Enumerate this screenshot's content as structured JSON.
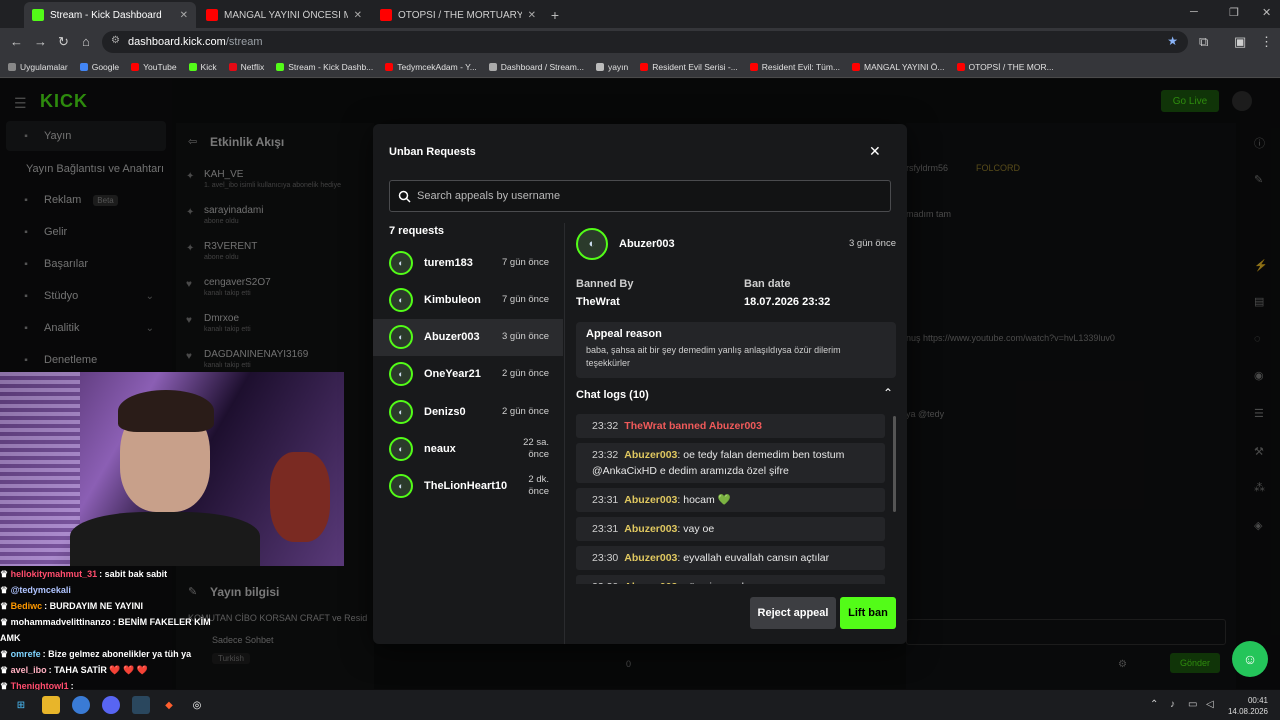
{
  "browser": {
    "tabs": [
      {
        "title": "Stream - Kick Dashboard",
        "favicon_color": "#53fc18",
        "active": true
      },
      {
        "title": "MANGAL YAYINI ÖNCESİ MEKİK",
        "favicon_color": "#ff0000",
        "active": false
      },
      {
        "title": "OTOPSİ / THE MORTUARY ASSI",
        "favicon_color": "#ff0000",
        "active": false
      }
    ],
    "url_host": "dashboard.kick.com",
    "url_path": "/stream",
    "bookmarks": [
      {
        "label": "Uygulamalar",
        "color": "#888888"
      },
      {
        "label": "Google",
        "color": "#4285f4"
      },
      {
        "label": "YouTube",
        "color": "#ff0000"
      },
      {
        "label": "Kick",
        "color": "#53fc18"
      },
      {
        "label": "Netflix",
        "color": "#e50914"
      },
      {
        "label": "Stream - Kick Dashb...",
        "color": "#53fc18"
      },
      {
        "label": "TedymcekAdam - Y...",
        "color": "#ff0000"
      },
      {
        "label": "Dashboard / Stream...",
        "color": "#aaaaaa"
      },
      {
        "label": "yayın",
        "color": "#bbbbbb"
      },
      {
        "label": "Resident Evil Serisi -...",
        "color": "#ff0000"
      },
      {
        "label": "Resident Evil: Tüm...",
        "color": "#ff0000"
      },
      {
        "label": "MANGAL YAYINI Ö...",
        "color": "#ff0000"
      },
      {
        "label": "OTOPSİ / THE MOR...",
        "color": "#ff0000"
      }
    ]
  },
  "dashboard": {
    "logo": "KICK",
    "go_live": "Go Live",
    "sidebar": [
      {
        "label": "Yayın",
        "icon": "broadcast-icon"
      },
      {
        "label": "Yayın Bağlantısı ve Anahtarı",
        "icon": ""
      },
      {
        "label": "Reklam",
        "icon": "ad-icon",
        "badge": "Beta"
      },
      {
        "label": "Gelir",
        "icon": "wallet-icon"
      },
      {
        "label": "Başarılar",
        "icon": "trophy-icon"
      },
      {
        "label": "Stüdyo",
        "icon": "studio-icon"
      },
      {
        "label": "Analitik",
        "icon": "chart-icon"
      },
      {
        "label": "Denetleme",
        "icon": "hammer-icon"
      }
    ],
    "activity_title": "Etkinlik Akışı",
    "activity": [
      {
        "name": "KAH_VE",
        "sub": "1. avel_ibo isimli kullanıcıya abonelik hediye"
      },
      {
        "name": "sarayinadami",
        "sub": "abone oldu"
      },
      {
        "name": "R3VERENT",
        "sub": "abone oldu"
      },
      {
        "name": "cengaverS2O7",
        "sub": "kanalı takip etti"
      },
      {
        "name": "Dmrxoe",
        "sub": "kanalı takip etti"
      },
      {
        "name": "DAGDANINENAYI3169",
        "sub": "kanalı takip etti"
      }
    ],
    "stream_info_title": "Yayın bilgisi",
    "stream_title": "KOMUTAN CİBO KORSAN CRAFT ve Resid",
    "category": "Sadece Sohbet",
    "language": "Turkish",
    "right_users": [
      "rsfyldrm56",
      "FOLCORD"
    ],
    "right_snippets": [
      "madım tam",
      "nuş https://www.youtube.com/watch?v=hvL1339luv0",
      "ya @tedy"
    ],
    "send_label": "Gönder",
    "viewers": "0"
  },
  "overlay_chat": [
    {
      "user": "hellokitymahmut_31",
      "color": "#ff4d6d",
      "text": ": sabit bak sabit"
    },
    {
      "user": "@tedymcekali",
      "color": "#b0c4ff",
      "text": ""
    },
    {
      "user": "Bediwc",
      "color": "#ff9900",
      "text": ": BURDAYIM NE YAYINI"
    },
    {
      "user": "mohammadvelittinanzo",
      "color": "#ffffff",
      "text": ": BENİM FAKELER KİM AMK"
    },
    {
      "user": "omrefe",
      "color": "#7fd4ff",
      "text": ": Bize gelmez abonelikler ya tüh ya"
    },
    {
      "user": "avel_ibo",
      "color": "#ffb0c0",
      "text": ": TAHA SATİR ❤️ ❤️ ❤️"
    },
    {
      "user": "Thenightowl1",
      "color": "#ff4d6d",
      "text": ":"
    }
  ],
  "modal": {
    "title": "Unban Requests",
    "search_placeholder": "Search appeals by username",
    "count_label": "7 requests",
    "requests": [
      {
        "name": "turem183",
        "time": "7 gün önce"
      },
      {
        "name": "Kimbuleon",
        "time": "7 gün önce"
      },
      {
        "name": "Abuzer003",
        "time": "3 gün önce",
        "selected": true
      },
      {
        "name": "OneYear21",
        "time": "2 gün önce"
      },
      {
        "name": "Denizs0",
        "time": "2 gün önce"
      },
      {
        "name": "neaux",
        "time": "22 sa. önce"
      },
      {
        "name": "TheLionHeart10",
        "time": "2 dk. önce"
      }
    ],
    "detail": {
      "name": "Abuzer003",
      "time": "3 gün önce",
      "banned_by_label": "Banned By",
      "banned_by": "TheWrat",
      "ban_date_label": "Ban date",
      "ban_date": "18.07.2026 23:32",
      "appeal_title": "Appeal reason",
      "appeal_text": "baba, şahsa ait bir şey demedim yanlış anlaşıldıysa özür dilerim teşekkürler",
      "logs_title": "Chat logs (10)",
      "logs": [
        {
          "time": "23:32",
          "user": "TheWrat banned Abuzer003",
          "text": "",
          "ban": true
        },
        {
          "time": "23:32",
          "user": "Abuzer003",
          "text": ": oe tedy falan demedim ben tostum @AnkaCixHD e dedim aramızda özel şifre"
        },
        {
          "time": "23:31",
          "user": "Abuzer003",
          "text": ": hocam 💚"
        },
        {
          "time": "23:31",
          "user": "Abuzer003",
          "text": ": vay oe"
        },
        {
          "time": "23:30",
          "user": "Abuzer003",
          "text": ": eyvallah euvallah cansın açtılar"
        },
        {
          "time": "23:30",
          "user": "Abuzer003",
          "text": ": görevim vardı"
        }
      ]
    },
    "reject_label": "Reject appeal",
    "lift_label": "Lift ban"
  },
  "taskbar": {
    "time": "00:41",
    "date": "14.08.2026"
  }
}
